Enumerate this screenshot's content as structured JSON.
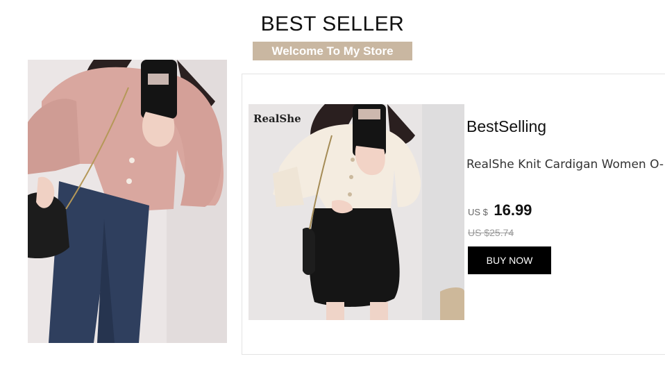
{
  "header": {
    "title": "BEST SELLER",
    "banner": "Welcome To My Store"
  },
  "hero_image": {
    "description_icon": "model-pink-cardigan-photo"
  },
  "product": {
    "image_icon": "model-cream-cardigan-photo",
    "watermark": "RealShe",
    "badge": "BestSelling",
    "title": "RealShe Knit Cardigan Women O-",
    "currency": "US $",
    "price": "16.99",
    "original_price": "US $25.74",
    "buy_label": "BUY NOW"
  },
  "colors": {
    "banner_bg": "#c9b7a1",
    "button_bg": "#000000"
  }
}
